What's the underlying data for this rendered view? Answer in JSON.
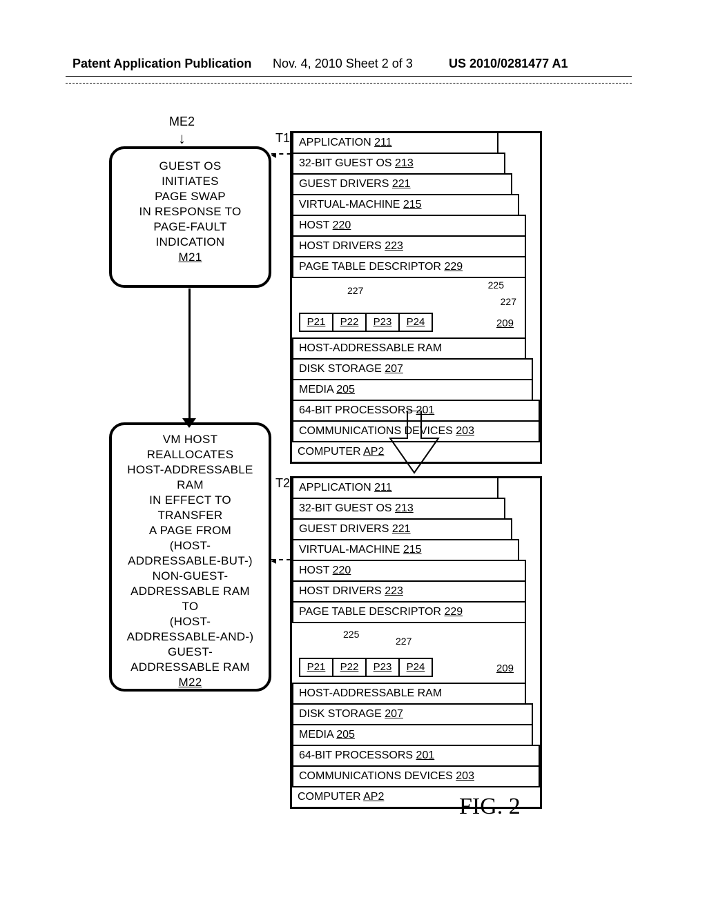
{
  "header": {
    "left": "Patent Application Publication",
    "middle": "Nov. 4, 2010  Sheet 2 of 3",
    "right": "US 2010/0281477 A1"
  },
  "me2_label": "ME2",
  "t1_label": "T1",
  "t2_label": "T2",
  "box_m21": {
    "lines": [
      "GUEST OS",
      "INITIATES",
      "PAGE SWAP",
      "IN RESPONSE TO",
      "PAGE-FAULT",
      "INDICATION"
    ],
    "ref": "M21"
  },
  "box_m22": {
    "lines": [
      "VM HOST",
      "REALLOCATES",
      "HOST-ADDRESSABLE",
      "RAM",
      "IN EFFECT TO",
      "TRANSFER",
      "A PAGE FROM",
      "(HOST-",
      "ADDRESSABLE-BUT-)",
      "NON-GUEST-",
      "ADDRESSABLE RAM",
      "TO",
      "(HOST-",
      "ADDRESSABLE-AND-)",
      "GUEST-",
      "ADDRESSABLE RAM"
    ],
    "ref": "M22"
  },
  "stack_common": {
    "app": {
      "label": "APPLICATION",
      "ref": "211"
    },
    "gos": {
      "label": "32-BIT GUEST OS",
      "ref": "213"
    },
    "gdrv": {
      "label": "GUEST DRIVERS",
      "ref": "221"
    },
    "vm": {
      "label": "VIRTUAL-MACHINE",
      "ref": "215"
    },
    "host": {
      "label": "HOST",
      "ref": "220"
    },
    "hdrv": {
      "label": "HOST DRIVERS",
      "ref": "223"
    },
    "ptd": {
      "label": "PAGE TABLE DESCRIPTOR",
      "ref": "229"
    },
    "pages": [
      "P21",
      "P22",
      "P23",
      "P24"
    ],
    "r209": "209",
    "ram_label": "HOST-ADDRESSABLE RAM",
    "disk": {
      "label": "DISK STORAGE",
      "ref": "207"
    },
    "media": {
      "label": "MEDIA",
      "ref": "205"
    },
    "proc": {
      "label": "64-BIT PROCESSORS",
      "ref": "201"
    },
    "comm": {
      "label": "COMMUNICATIONS DEVICES",
      "ref": "203"
    },
    "comp": {
      "label": "COMPUTER",
      "ref": "AP2"
    }
  },
  "t1_leads": {
    "l225": "225",
    "l227": "227",
    "l227b": "227"
  },
  "t2_leads": {
    "l225": "225",
    "l227": "227"
  },
  "figure_caption": "FIG. 2"
}
